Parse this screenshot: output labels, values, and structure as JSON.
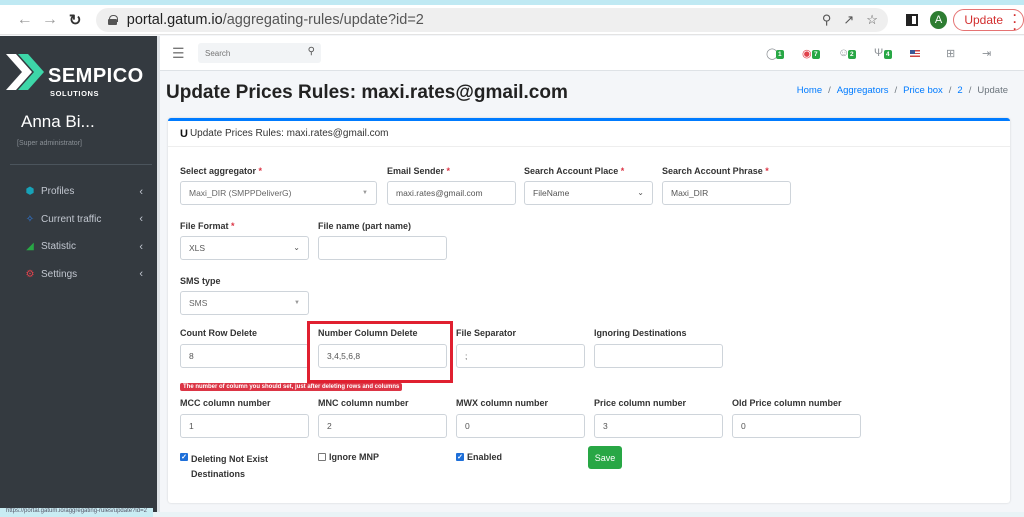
{
  "browser": {
    "url_host": "portal.gatum.io",
    "url_path": "/aggregating-rules/update?id=2",
    "profile_initial": "A",
    "update_label": "Update"
  },
  "sidebar": {
    "brand": "SEMPICO",
    "brand_sub": "SOLUTIONS",
    "user_name": "Anna Bi...",
    "user_role": "[Super administrator]",
    "items": [
      {
        "label": "Profiles",
        "icon": "profiles-icon",
        "color": "#17a2b8"
      },
      {
        "label": "Current traffic",
        "icon": "traffic-icon",
        "color": "#2f7ee6"
      },
      {
        "label": "Statistic",
        "icon": "statistic-icon",
        "color": "#28a745"
      },
      {
        "label": "Settings",
        "icon": "settings-icon",
        "color": "#e0424c"
      }
    ]
  },
  "topnav": {
    "search_placeholder": "Search",
    "badges": [
      {
        "icon": "messages-icon",
        "count": "1"
      },
      {
        "icon": "alerts-icon",
        "count": "7"
      },
      {
        "icon": "users-icon",
        "count": "2"
      },
      {
        "icon": "support-icon",
        "count": "4"
      }
    ]
  },
  "page": {
    "title": "Update Prices Rules: maxi.rates@gmail.com",
    "breadcrumb": [
      "Home",
      "Aggregators",
      "Price box",
      "2",
      "Update"
    ],
    "card_title": "Update Prices Rules: maxi.rates@gmail.com"
  },
  "form": {
    "aggregator": {
      "label": "Select aggregator",
      "value": "Maxi_DIR (SMPPDeliverG)",
      "required": true
    },
    "email_sender": {
      "label": "Email Sender",
      "value": "maxi.rates@gmail.com",
      "required": true
    },
    "account_place": {
      "label": "Search Account Place",
      "value": "FileName",
      "required": true
    },
    "account_phrase": {
      "label": "Search Account Phrase",
      "value": "Maxi_DIR",
      "required": true
    },
    "file_format": {
      "label": "File Format",
      "value": "XLS",
      "required": true
    },
    "file_name": {
      "label": "File name (part name)",
      "value": ""
    },
    "sms_type": {
      "label": "SMS type",
      "value": "SMS"
    },
    "count_row_delete": {
      "label": "Count Row Delete",
      "value": "8"
    },
    "number_column_delete": {
      "label": "Number Column Delete",
      "value": "3,4,5,6,8"
    },
    "file_separator": {
      "label": "File Separator",
      "value": ";"
    },
    "ignoring_destinations": {
      "label": "Ignoring Destinations",
      "value": ""
    },
    "hint": "The number of column you should set, just after deleting rows and columns",
    "mcc": {
      "label": "MCC column number",
      "value": "1"
    },
    "mnc": {
      "label": "MNC column number",
      "value": "2"
    },
    "mwx": {
      "label": "MWX column number",
      "value": "0"
    },
    "price": {
      "label": "Price column number",
      "value": "3"
    },
    "old_price": {
      "label": "Old Price column number",
      "value": "0"
    },
    "deleting_not_exist": {
      "label": "Deleting Not Exist Destinations",
      "checked": true
    },
    "ignore_mnp": {
      "label": "Ignore MNP",
      "checked": false
    },
    "enabled": {
      "label": "Enabled",
      "checked": true
    },
    "save_label": "Save"
  },
  "status_bar": {
    "text": "https://portal.gatum.io/aggregating-rules/update?id=2"
  }
}
